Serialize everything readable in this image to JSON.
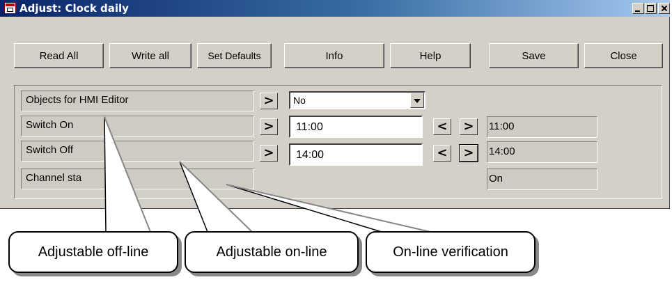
{
  "window": {
    "title": "Adjust: Clock daily"
  },
  "toolbar": {
    "read_all": "Read All",
    "write_all": "Write all",
    "set_defaults": "Set Defaults",
    "info": "Info",
    "help": "Help",
    "save": "Save",
    "close": "Close"
  },
  "rows": [
    {
      "label": "Objects for HMI Editor",
      "value": "No"
    },
    {
      "label": "Switch On",
      "value": "11:00",
      "online": "11:00"
    },
    {
      "label": "Switch Off",
      "value": "14:00",
      "online": "14:00"
    },
    {
      "label": "Channel sta",
      "online": "On"
    }
  ],
  "glyphs": {
    "right": ">",
    "left": "<"
  },
  "callouts": {
    "offline": "Adjustable off-line",
    "online": "Adjustable on-line",
    "verification": "On-line verification"
  }
}
